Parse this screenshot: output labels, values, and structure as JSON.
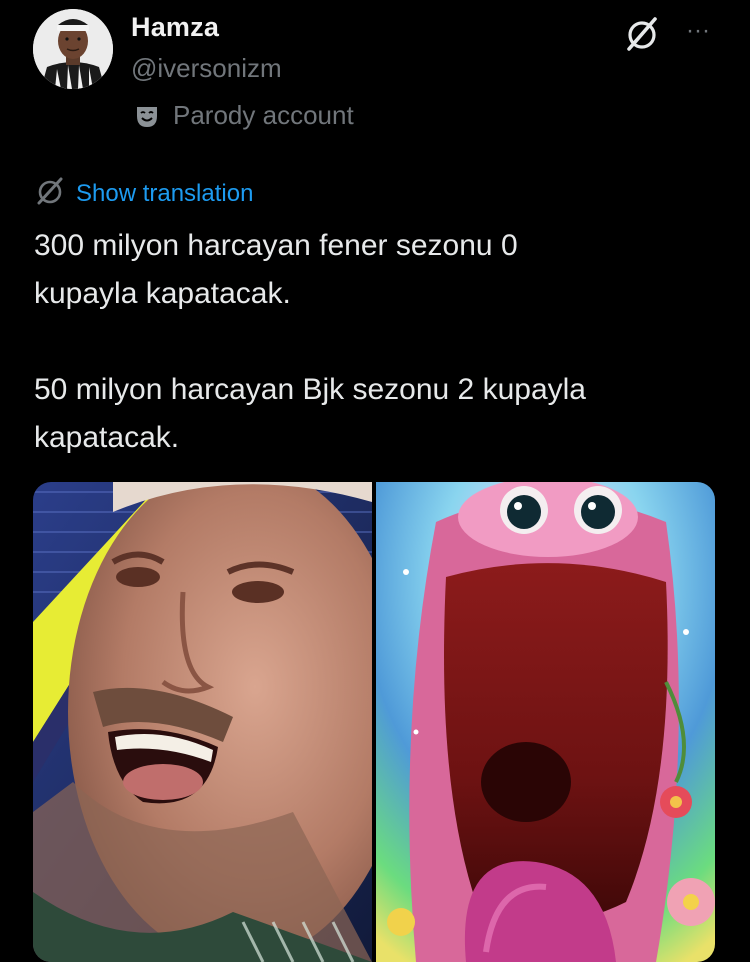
{
  "post": {
    "author": {
      "display_name": "Hamza",
      "handle": "@iversonizm",
      "badge_label": "Parody account",
      "badge_icon": "theater-mask-icon",
      "avatar_icon": "avatar"
    },
    "actions": {
      "grok_icon": "grok-icon",
      "more_icon": "more-dots-icon",
      "more_glyph": "···"
    },
    "translation": {
      "label": "Show translation",
      "icon": "grok-icon"
    },
    "text": "300 milyon harcayan fener sezonu 0\nkupayla kapatacak.\n\n50 milyon harcayan Bjk sezonu 2 kupayla\nkapatacak.",
    "media": [
      {
        "icon": "photo-laughing-man"
      },
      {
        "icon": "photo-screaming-cartoon"
      }
    ]
  },
  "colors": {
    "background": "#000000",
    "text_primary": "#e7e9ea",
    "text_secondary": "#71767b",
    "accent": "#1d9bf0"
  }
}
